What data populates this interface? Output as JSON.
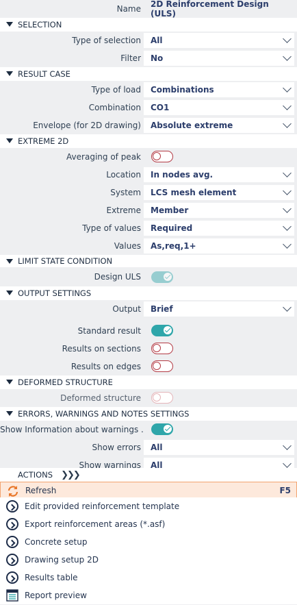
{
  "header": {
    "name_label": "Name",
    "name_value": "2D Reinforcement Design (ULS)"
  },
  "sections": {
    "selection": {
      "title": "SELECTION",
      "type_label": "Type of selection",
      "type_value": "All",
      "filter_label": "Filter",
      "filter_value": "No"
    },
    "result_case": {
      "title": "RESULT CASE",
      "load_label": "Type of load",
      "load_value": "Combinations",
      "comb_label": "Combination",
      "comb_value": "CO1",
      "env_label": "Envelope (for 2D drawing)",
      "env_value": "Absolute extreme"
    },
    "extreme": {
      "title": "EXTREME 2D",
      "avg_label": "Averaging of peak",
      "avg_on": false,
      "loc_label": "Location",
      "loc_value": "In nodes avg.",
      "sys_label": "System",
      "sys_value": "LCS mesh element",
      "ext_label": "Extreme",
      "ext_value": "Member",
      "tov_label": "Type of values",
      "tov_value": "Required",
      "val_label": "Values",
      "val_value": "As,req,1+"
    },
    "limit": {
      "title": "LIMIT STATE CONDITION",
      "uls_label": "Design ULS",
      "uls_on": true
    },
    "output": {
      "title": "OUTPUT SETTINGS",
      "out_label": "Output",
      "out_value": "Brief",
      "std_label": "Standard result",
      "std_on": true,
      "sec_label": "Results on sections",
      "sec_on": false,
      "edge_label": "Results on edges",
      "edge_on": false
    },
    "deformed": {
      "title": "DEFORMED STRUCTURE",
      "def_label": "Deformed structure",
      "def_on": false
    },
    "errors": {
      "title": "ERRORS, WARNINGS AND NOTES SETTINGS",
      "info_label": "Show Information about warnings ...",
      "info_on": true,
      "err_label": "Show errors",
      "err_value": "All",
      "warn_label": "Show warnings",
      "warn_value": "All"
    }
  },
  "actions": {
    "title": "ACTIONS",
    "items": [
      {
        "label": "Refresh",
        "shortcut": "F5",
        "icon": "refresh-icon"
      },
      {
        "label": "Edit provided reinforcement template",
        "icon": "chevron-circle-icon"
      },
      {
        "label": "Export reinforcement areas (*.asf)",
        "icon": "chevron-circle-icon"
      },
      {
        "label": "Concrete setup",
        "icon": "chevron-circle-icon"
      },
      {
        "label": "Drawing setup 2D",
        "icon": "chevron-circle-icon"
      },
      {
        "label": "Results table",
        "icon": "chevron-circle-icon"
      },
      {
        "label": "Report preview",
        "icon": "report-preview-icon"
      }
    ]
  },
  "colors": {
    "accent": "#2fa6aa",
    "toggle_off": "#b33a44",
    "highlight": "#f2a470"
  }
}
